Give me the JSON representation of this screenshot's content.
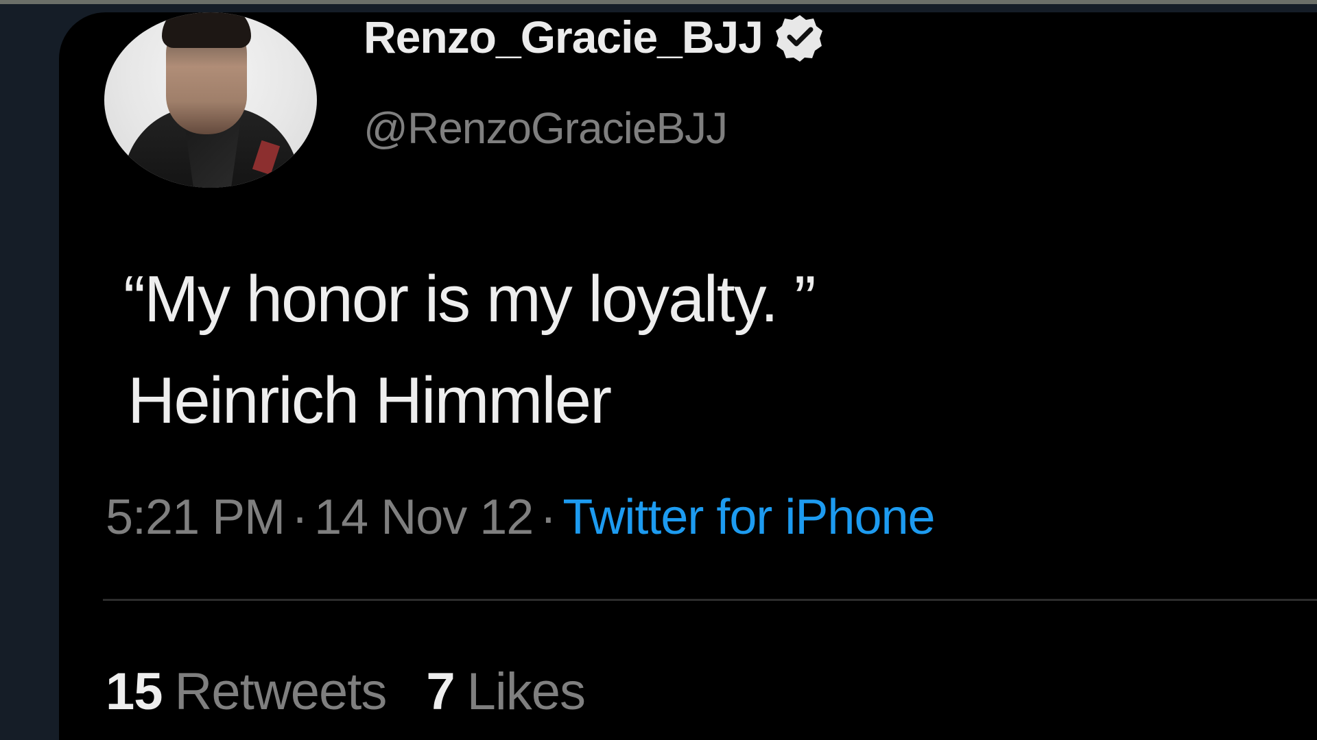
{
  "tweet": {
    "author": {
      "display_name": "Renzo_Gracie_BJJ",
      "handle": "@RenzoGracieBJJ",
      "verified_icon": "verified-badge-icon"
    },
    "text": {
      "line1": "“My honor is my loyalty. ”",
      "line2": "Heinrich Himmler"
    },
    "meta": {
      "time": "5:21 PM",
      "separator": "·",
      "date": "14 Nov 12",
      "source": "Twitter for iPhone"
    },
    "stats": {
      "retweets_count": "15",
      "retweets_label": "Retweets",
      "likes_count": "7",
      "likes_label": "Likes"
    },
    "colors": {
      "card_background": "#000000",
      "page_background": "#151d27",
      "text_primary": "#eeeeee",
      "text_secondary": "#7f7f7f",
      "link": "#1d9bf0"
    }
  }
}
